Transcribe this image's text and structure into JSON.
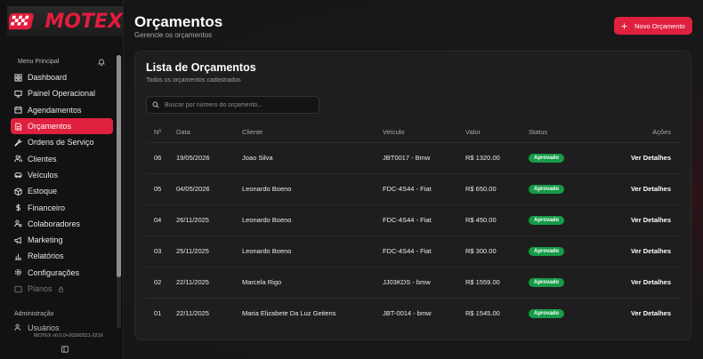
{
  "brand": {
    "name": "MOTEX",
    "accent": "#e0203f"
  },
  "sidebar": {
    "menu_header": "Menu Principal",
    "items": [
      {
        "label": "Dashboard",
        "icon": "dashboard-icon"
      },
      {
        "label": "Painel Operacional",
        "icon": "monitor-icon"
      },
      {
        "label": "Agendamentos",
        "icon": "calendar-icon"
      },
      {
        "label": "Orçamentos",
        "icon": "document-icon",
        "active": true
      },
      {
        "label": "Ordens de Serviço",
        "icon": "wrench-icon"
      },
      {
        "label": "Clientes",
        "icon": "users-icon"
      },
      {
        "label": "Veículos",
        "icon": "car-icon"
      },
      {
        "label": "Estoque",
        "icon": "box-icon"
      },
      {
        "label": "Financeiro",
        "icon": "dollar-icon"
      },
      {
        "label": "Colaboradores",
        "icon": "user-cog-icon"
      },
      {
        "label": "Marketing",
        "icon": "megaphone-icon"
      },
      {
        "label": "Relatórios",
        "icon": "bar-chart-icon"
      },
      {
        "label": "Configurações",
        "icon": "gear-icon"
      },
      {
        "label": "Planos",
        "icon": "box-icon",
        "muted": true
      }
    ],
    "admin_header": "Administração",
    "admin_item": "Usuários",
    "version": "MOTEX v0.0.0+20260521-2216"
  },
  "header": {
    "title": "Orçamentos",
    "subtitle": "Gerencie os orçamentos",
    "new_button": "Novo Orçamento"
  },
  "card": {
    "title": "Lista de Orçamentos",
    "subtitle": "Todos os orçamentos cadastrados",
    "search_placeholder": "Buscar por número do orçamento..."
  },
  "table": {
    "headers": [
      "Nº",
      "Data",
      "Cliente",
      "Veículo",
      "Valor",
      "Status",
      "Ações"
    ],
    "rows": [
      {
        "no": "06",
        "date": "19/05/2026",
        "client": "Joao Silva",
        "vehicle": "JBT0017 - Bmw",
        "value": "R$ 1320.00",
        "status": "Aprovado",
        "action": "Ver Detalhes"
      },
      {
        "no": "05",
        "date": "04/05/2026",
        "client": "Leonardo Boeno",
        "vehicle": "FDC-4S44 - Fiat",
        "value": "R$ 650.00",
        "status": "Aprovado",
        "action": "Ver Detalhes"
      },
      {
        "no": "04",
        "date": "26/11/2025",
        "client": "Leonardo Boeno",
        "vehicle": "FDC-4S44 - Fiat",
        "value": "R$ 450.00",
        "status": "Aprovado",
        "action": "Ver Detalhes"
      },
      {
        "no": "03",
        "date": "25/11/2025",
        "client": "Leonardo Boeno",
        "vehicle": "FDC-4S44 - Fiat",
        "value": "R$ 300.00",
        "status": "Aprovado",
        "action": "Ver Detalhes"
      },
      {
        "no": "02",
        "date": "22/11/2025",
        "client": "Marcela Rigo",
        "vehicle": "JJ03KDS - bmw",
        "value": "R$ 1559.00",
        "status": "Aprovado",
        "action": "Ver Detalhes"
      },
      {
        "no": "01",
        "date": "22/11/2025",
        "client": "Maria Elizabete Da Luz Geitens",
        "vehicle": "JBT-0014 - bmw",
        "value": "R$ 1545.00",
        "status": "Aprovado",
        "action": "Ver Detalhes"
      }
    ]
  },
  "colors": {
    "status_approved": "#169b48",
    "accent": "#e0203f"
  }
}
